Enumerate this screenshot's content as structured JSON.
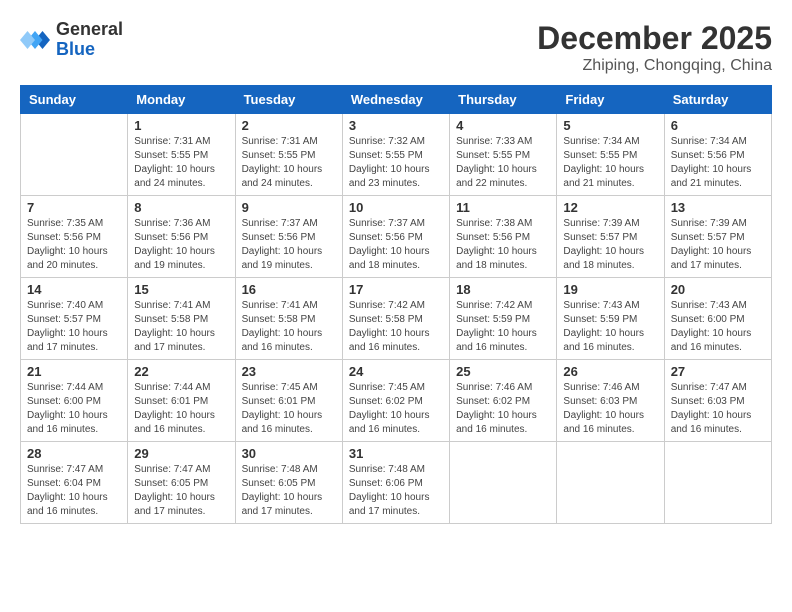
{
  "header": {
    "logo_general": "General",
    "logo_blue": "Blue",
    "month_title": "December 2025",
    "location": "Zhiping, Chongqing, China"
  },
  "days_of_week": [
    "Sunday",
    "Monday",
    "Tuesday",
    "Wednesday",
    "Thursday",
    "Friday",
    "Saturday"
  ],
  "weeks": [
    [
      {
        "day": "",
        "info": ""
      },
      {
        "day": "1",
        "info": "Sunrise: 7:31 AM\nSunset: 5:55 PM\nDaylight: 10 hours\nand 24 minutes."
      },
      {
        "day": "2",
        "info": "Sunrise: 7:31 AM\nSunset: 5:55 PM\nDaylight: 10 hours\nand 24 minutes."
      },
      {
        "day": "3",
        "info": "Sunrise: 7:32 AM\nSunset: 5:55 PM\nDaylight: 10 hours\nand 23 minutes."
      },
      {
        "day": "4",
        "info": "Sunrise: 7:33 AM\nSunset: 5:55 PM\nDaylight: 10 hours\nand 22 minutes."
      },
      {
        "day": "5",
        "info": "Sunrise: 7:34 AM\nSunset: 5:55 PM\nDaylight: 10 hours\nand 21 minutes."
      },
      {
        "day": "6",
        "info": "Sunrise: 7:34 AM\nSunset: 5:56 PM\nDaylight: 10 hours\nand 21 minutes."
      }
    ],
    [
      {
        "day": "7",
        "info": "Sunrise: 7:35 AM\nSunset: 5:56 PM\nDaylight: 10 hours\nand 20 minutes."
      },
      {
        "day": "8",
        "info": "Sunrise: 7:36 AM\nSunset: 5:56 PM\nDaylight: 10 hours\nand 19 minutes."
      },
      {
        "day": "9",
        "info": "Sunrise: 7:37 AM\nSunset: 5:56 PM\nDaylight: 10 hours\nand 19 minutes."
      },
      {
        "day": "10",
        "info": "Sunrise: 7:37 AM\nSunset: 5:56 PM\nDaylight: 10 hours\nand 18 minutes."
      },
      {
        "day": "11",
        "info": "Sunrise: 7:38 AM\nSunset: 5:56 PM\nDaylight: 10 hours\nand 18 minutes."
      },
      {
        "day": "12",
        "info": "Sunrise: 7:39 AM\nSunset: 5:57 PM\nDaylight: 10 hours\nand 18 minutes."
      },
      {
        "day": "13",
        "info": "Sunrise: 7:39 AM\nSunset: 5:57 PM\nDaylight: 10 hours\nand 17 minutes."
      }
    ],
    [
      {
        "day": "14",
        "info": "Sunrise: 7:40 AM\nSunset: 5:57 PM\nDaylight: 10 hours\nand 17 minutes."
      },
      {
        "day": "15",
        "info": "Sunrise: 7:41 AM\nSunset: 5:58 PM\nDaylight: 10 hours\nand 17 minutes."
      },
      {
        "day": "16",
        "info": "Sunrise: 7:41 AM\nSunset: 5:58 PM\nDaylight: 10 hours\nand 16 minutes."
      },
      {
        "day": "17",
        "info": "Sunrise: 7:42 AM\nSunset: 5:58 PM\nDaylight: 10 hours\nand 16 minutes."
      },
      {
        "day": "18",
        "info": "Sunrise: 7:42 AM\nSunset: 5:59 PM\nDaylight: 10 hours\nand 16 minutes."
      },
      {
        "day": "19",
        "info": "Sunrise: 7:43 AM\nSunset: 5:59 PM\nDaylight: 10 hours\nand 16 minutes."
      },
      {
        "day": "20",
        "info": "Sunrise: 7:43 AM\nSunset: 6:00 PM\nDaylight: 10 hours\nand 16 minutes."
      }
    ],
    [
      {
        "day": "21",
        "info": "Sunrise: 7:44 AM\nSunset: 6:00 PM\nDaylight: 10 hours\nand 16 minutes."
      },
      {
        "day": "22",
        "info": "Sunrise: 7:44 AM\nSunset: 6:01 PM\nDaylight: 10 hours\nand 16 minutes."
      },
      {
        "day": "23",
        "info": "Sunrise: 7:45 AM\nSunset: 6:01 PM\nDaylight: 10 hours\nand 16 minutes."
      },
      {
        "day": "24",
        "info": "Sunrise: 7:45 AM\nSunset: 6:02 PM\nDaylight: 10 hours\nand 16 minutes."
      },
      {
        "day": "25",
        "info": "Sunrise: 7:46 AM\nSunset: 6:02 PM\nDaylight: 10 hours\nand 16 minutes."
      },
      {
        "day": "26",
        "info": "Sunrise: 7:46 AM\nSunset: 6:03 PM\nDaylight: 10 hours\nand 16 minutes."
      },
      {
        "day": "27",
        "info": "Sunrise: 7:47 AM\nSunset: 6:03 PM\nDaylight: 10 hours\nand 16 minutes."
      }
    ],
    [
      {
        "day": "28",
        "info": "Sunrise: 7:47 AM\nSunset: 6:04 PM\nDaylight: 10 hours\nand 16 minutes."
      },
      {
        "day": "29",
        "info": "Sunrise: 7:47 AM\nSunset: 6:05 PM\nDaylight: 10 hours\nand 17 minutes."
      },
      {
        "day": "30",
        "info": "Sunrise: 7:48 AM\nSunset: 6:05 PM\nDaylight: 10 hours\nand 17 minutes."
      },
      {
        "day": "31",
        "info": "Sunrise: 7:48 AM\nSunset: 6:06 PM\nDaylight: 10 hours\nand 17 minutes."
      },
      {
        "day": "",
        "info": ""
      },
      {
        "day": "",
        "info": ""
      },
      {
        "day": "",
        "info": ""
      }
    ]
  ]
}
